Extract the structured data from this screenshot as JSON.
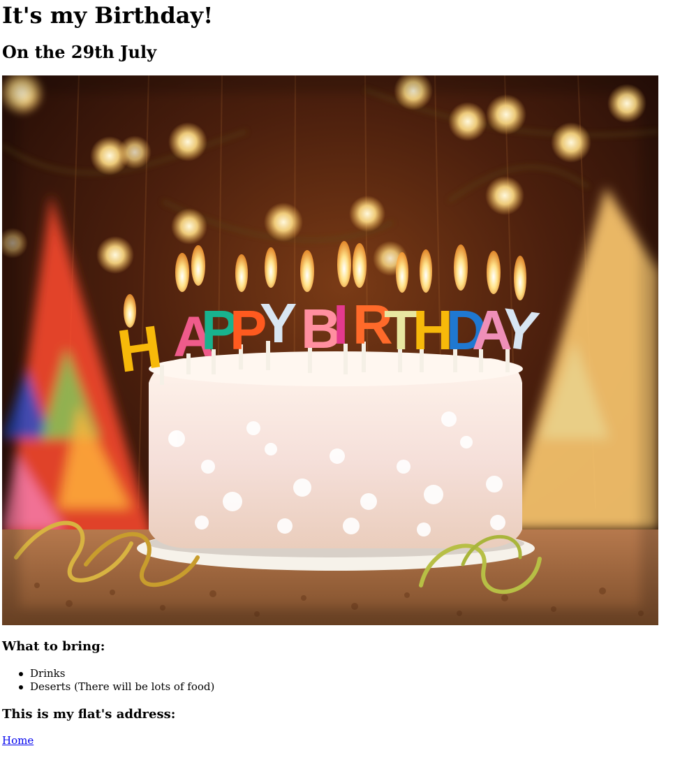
{
  "page": {
    "title": "It's my Birthday!",
    "subtitle": "On the 29th July"
  },
  "hero": {
    "candle_letters": [
      "H",
      "A",
      "P",
      "P",
      "Y",
      "B",
      "I",
      "R",
      "T",
      "H",
      "D",
      "A",
      "Y"
    ],
    "candle_colors": [
      "#f7b90a",
      "#ef5b8b",
      "#18b38e",
      "#ff5a1f",
      "#d9e6f2",
      "#ff8fa0",
      "#e43a8e",
      "#ff6a2a",
      "#e8e7a1",
      "#f7b90a",
      "#1f78d1",
      "#ef8fb8",
      "#d8e6f3"
    ]
  },
  "bring": {
    "heading": "What to bring:",
    "items": [
      "Drinks",
      "Deserts (There will be lots of food)"
    ]
  },
  "address": {
    "heading": "This is my flat's address:"
  },
  "nav": {
    "home_label": "Home"
  }
}
